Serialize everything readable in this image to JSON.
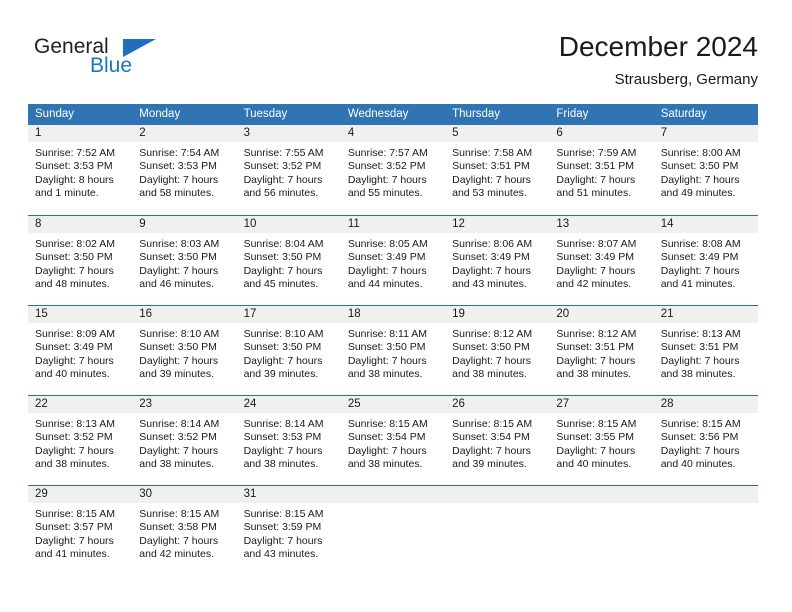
{
  "brand": {
    "name_top": "General",
    "name_bottom": "Blue",
    "color_dark": "#231f20",
    "color_blue": "#1878be",
    "triangle_color": "#1f6fc0"
  },
  "header": {
    "title": "December 2024",
    "subtitle": "Strausberg, Germany",
    "header_bg": "#3074b4",
    "band_bg": "#f0f0f0",
    "rule_color": "#2e6da9"
  },
  "weekdays": [
    "Sunday",
    "Monday",
    "Tuesday",
    "Wednesday",
    "Thursday",
    "Friday",
    "Saturday"
  ],
  "weeks": [
    [
      {
        "day": "1",
        "sunrise": "Sunrise: 7:52 AM",
        "sunset": "Sunset: 3:53 PM",
        "daylight_1": "Daylight: 8 hours",
        "daylight_2": "and 1 minute."
      },
      {
        "day": "2",
        "sunrise": "Sunrise: 7:54 AM",
        "sunset": "Sunset: 3:53 PM",
        "daylight_1": "Daylight: 7 hours",
        "daylight_2": "and 58 minutes."
      },
      {
        "day": "3",
        "sunrise": "Sunrise: 7:55 AM",
        "sunset": "Sunset: 3:52 PM",
        "daylight_1": "Daylight: 7 hours",
        "daylight_2": "and 56 minutes."
      },
      {
        "day": "4",
        "sunrise": "Sunrise: 7:57 AM",
        "sunset": "Sunset: 3:52 PM",
        "daylight_1": "Daylight: 7 hours",
        "daylight_2": "and 55 minutes."
      },
      {
        "day": "5",
        "sunrise": "Sunrise: 7:58 AM",
        "sunset": "Sunset: 3:51 PM",
        "daylight_1": "Daylight: 7 hours",
        "daylight_2": "and 53 minutes."
      },
      {
        "day": "6",
        "sunrise": "Sunrise: 7:59 AM",
        "sunset": "Sunset: 3:51 PM",
        "daylight_1": "Daylight: 7 hours",
        "daylight_2": "and 51 minutes."
      },
      {
        "day": "7",
        "sunrise": "Sunrise: 8:00 AM",
        "sunset": "Sunset: 3:50 PM",
        "daylight_1": "Daylight: 7 hours",
        "daylight_2": "and 49 minutes."
      }
    ],
    [
      {
        "day": "8",
        "sunrise": "Sunrise: 8:02 AM",
        "sunset": "Sunset: 3:50 PM",
        "daylight_1": "Daylight: 7 hours",
        "daylight_2": "and 48 minutes."
      },
      {
        "day": "9",
        "sunrise": "Sunrise: 8:03 AM",
        "sunset": "Sunset: 3:50 PM",
        "daylight_1": "Daylight: 7 hours",
        "daylight_2": "and 46 minutes."
      },
      {
        "day": "10",
        "sunrise": "Sunrise: 8:04 AM",
        "sunset": "Sunset: 3:50 PM",
        "daylight_1": "Daylight: 7 hours",
        "daylight_2": "and 45 minutes."
      },
      {
        "day": "11",
        "sunrise": "Sunrise: 8:05 AM",
        "sunset": "Sunset: 3:49 PM",
        "daylight_1": "Daylight: 7 hours",
        "daylight_2": "and 44 minutes."
      },
      {
        "day": "12",
        "sunrise": "Sunrise: 8:06 AM",
        "sunset": "Sunset: 3:49 PM",
        "daylight_1": "Daylight: 7 hours",
        "daylight_2": "and 43 minutes."
      },
      {
        "day": "13",
        "sunrise": "Sunrise: 8:07 AM",
        "sunset": "Sunset: 3:49 PM",
        "daylight_1": "Daylight: 7 hours",
        "daylight_2": "and 42 minutes."
      },
      {
        "day": "14",
        "sunrise": "Sunrise: 8:08 AM",
        "sunset": "Sunset: 3:49 PM",
        "daylight_1": "Daylight: 7 hours",
        "daylight_2": "and 41 minutes."
      }
    ],
    [
      {
        "day": "15",
        "sunrise": "Sunrise: 8:09 AM",
        "sunset": "Sunset: 3:49 PM",
        "daylight_1": "Daylight: 7 hours",
        "daylight_2": "and 40 minutes."
      },
      {
        "day": "16",
        "sunrise": "Sunrise: 8:10 AM",
        "sunset": "Sunset: 3:50 PM",
        "daylight_1": "Daylight: 7 hours",
        "daylight_2": "and 39 minutes."
      },
      {
        "day": "17",
        "sunrise": "Sunrise: 8:10 AM",
        "sunset": "Sunset: 3:50 PM",
        "daylight_1": "Daylight: 7 hours",
        "daylight_2": "and 39 minutes."
      },
      {
        "day": "18",
        "sunrise": "Sunrise: 8:11 AM",
        "sunset": "Sunset: 3:50 PM",
        "daylight_1": "Daylight: 7 hours",
        "daylight_2": "and 38 minutes."
      },
      {
        "day": "19",
        "sunrise": "Sunrise: 8:12 AM",
        "sunset": "Sunset: 3:50 PM",
        "daylight_1": "Daylight: 7 hours",
        "daylight_2": "and 38 minutes."
      },
      {
        "day": "20",
        "sunrise": "Sunrise: 8:12 AM",
        "sunset": "Sunset: 3:51 PM",
        "daylight_1": "Daylight: 7 hours",
        "daylight_2": "and 38 minutes."
      },
      {
        "day": "21",
        "sunrise": "Sunrise: 8:13 AM",
        "sunset": "Sunset: 3:51 PM",
        "daylight_1": "Daylight: 7 hours",
        "daylight_2": "and 38 minutes."
      }
    ],
    [
      {
        "day": "22",
        "sunrise": "Sunrise: 8:13 AM",
        "sunset": "Sunset: 3:52 PM",
        "daylight_1": "Daylight: 7 hours",
        "daylight_2": "and 38 minutes."
      },
      {
        "day": "23",
        "sunrise": "Sunrise: 8:14 AM",
        "sunset": "Sunset: 3:52 PM",
        "daylight_1": "Daylight: 7 hours",
        "daylight_2": "and 38 minutes."
      },
      {
        "day": "24",
        "sunrise": "Sunrise: 8:14 AM",
        "sunset": "Sunset: 3:53 PM",
        "daylight_1": "Daylight: 7 hours",
        "daylight_2": "and 38 minutes."
      },
      {
        "day": "25",
        "sunrise": "Sunrise: 8:15 AM",
        "sunset": "Sunset: 3:54 PM",
        "daylight_1": "Daylight: 7 hours",
        "daylight_2": "and 38 minutes."
      },
      {
        "day": "26",
        "sunrise": "Sunrise: 8:15 AM",
        "sunset": "Sunset: 3:54 PM",
        "daylight_1": "Daylight: 7 hours",
        "daylight_2": "and 39 minutes."
      },
      {
        "day": "27",
        "sunrise": "Sunrise: 8:15 AM",
        "sunset": "Sunset: 3:55 PM",
        "daylight_1": "Daylight: 7 hours",
        "daylight_2": "and 40 minutes."
      },
      {
        "day": "28",
        "sunrise": "Sunrise: 8:15 AM",
        "sunset": "Sunset: 3:56 PM",
        "daylight_1": "Daylight: 7 hours",
        "daylight_2": "and 40 minutes."
      }
    ],
    [
      {
        "day": "29",
        "sunrise": "Sunrise: 8:15 AM",
        "sunset": "Sunset: 3:57 PM",
        "daylight_1": "Daylight: 7 hours",
        "daylight_2": "and 41 minutes."
      },
      {
        "day": "30",
        "sunrise": "Sunrise: 8:15 AM",
        "sunset": "Sunset: 3:58 PM",
        "daylight_1": "Daylight: 7 hours",
        "daylight_2": "and 42 minutes."
      },
      {
        "day": "31",
        "sunrise": "Sunrise: 8:15 AM",
        "sunset": "Sunset: 3:59 PM",
        "daylight_1": "Daylight: 7 hours",
        "daylight_2": "and 43 minutes."
      },
      {
        "day": "",
        "sunrise": "",
        "sunset": "",
        "daylight_1": "",
        "daylight_2": ""
      },
      {
        "day": "",
        "sunrise": "",
        "sunset": "",
        "daylight_1": "",
        "daylight_2": ""
      },
      {
        "day": "",
        "sunrise": "",
        "sunset": "",
        "daylight_1": "",
        "daylight_2": ""
      },
      {
        "day": "",
        "sunrise": "",
        "sunset": "",
        "daylight_1": "",
        "daylight_2": ""
      }
    ]
  ]
}
